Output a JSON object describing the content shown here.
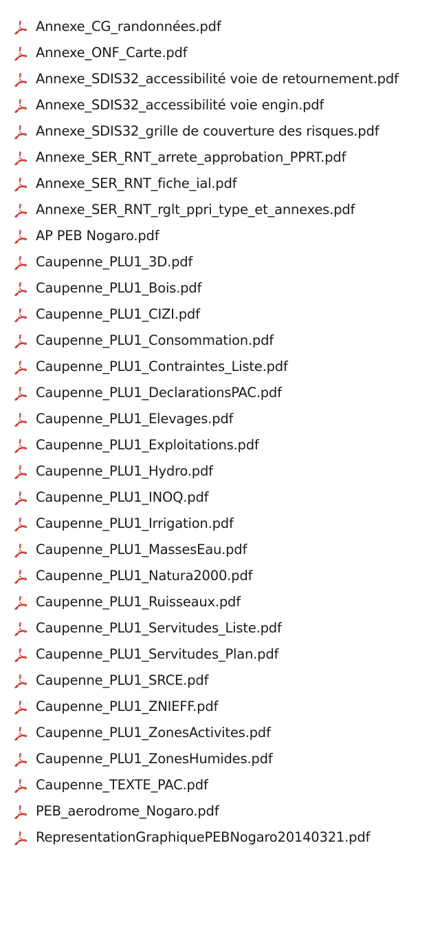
{
  "file_list": {
    "icon": "pdf-file-icon",
    "icon_color": "#d9261c",
    "items": [
      {
        "name": "Annexe_CG_randonnées.pdf"
      },
      {
        "name": "Annexe_ONF_Carte.pdf"
      },
      {
        "name": "Annexe_SDIS32_accessibilité voie de retournement.pdf"
      },
      {
        "name": "Annexe_SDIS32_accessibilité voie engin.pdf"
      },
      {
        "name": "Annexe_SDIS32_grille de couverture des risques.pdf"
      },
      {
        "name": "Annexe_SER_RNT_arrete_approbation_PPRT.pdf"
      },
      {
        "name": "Annexe_SER_RNT_fiche_ial.pdf"
      },
      {
        "name": "Annexe_SER_RNT_rglt_ppri_type_et_annexes.pdf"
      },
      {
        "name": "AP PEB Nogaro.pdf"
      },
      {
        "name": "Caupenne_PLU1_3D.pdf"
      },
      {
        "name": "Caupenne_PLU1_Bois.pdf"
      },
      {
        "name": "Caupenne_PLU1_CIZI.pdf"
      },
      {
        "name": "Caupenne_PLU1_Consommation.pdf"
      },
      {
        "name": "Caupenne_PLU1_Contraintes_Liste.pdf"
      },
      {
        "name": "Caupenne_PLU1_DeclarationsPAC.pdf"
      },
      {
        "name": "Caupenne_PLU1_Elevages.pdf"
      },
      {
        "name": "Caupenne_PLU1_Exploitations.pdf"
      },
      {
        "name": "Caupenne_PLU1_Hydro.pdf"
      },
      {
        "name": "Caupenne_PLU1_INOQ.pdf"
      },
      {
        "name": "Caupenne_PLU1_Irrigation.pdf"
      },
      {
        "name": "Caupenne_PLU1_MassesEau.pdf"
      },
      {
        "name": "Caupenne_PLU1_Natura2000.pdf"
      },
      {
        "name": "Caupenne_PLU1_Ruisseaux.pdf"
      },
      {
        "name": "Caupenne_PLU1_Servitudes_Liste.pdf"
      },
      {
        "name": "Caupenne_PLU1_Servitudes_Plan.pdf"
      },
      {
        "name": "Caupenne_PLU1_SRCE.pdf"
      },
      {
        "name": "Caupenne_PLU1_ZNIEFF.pdf"
      },
      {
        "name": "Caupenne_PLU1_ZonesActivites.pdf"
      },
      {
        "name": "Caupenne_PLU1_ZonesHumides.pdf"
      },
      {
        "name": "Caupenne_TEXTE_PAC.pdf"
      },
      {
        "name": "PEB_aerodrome_Nogaro.pdf"
      },
      {
        "name": "RepresentationGraphiquePEBNogaro20140321.pdf"
      }
    ]
  }
}
